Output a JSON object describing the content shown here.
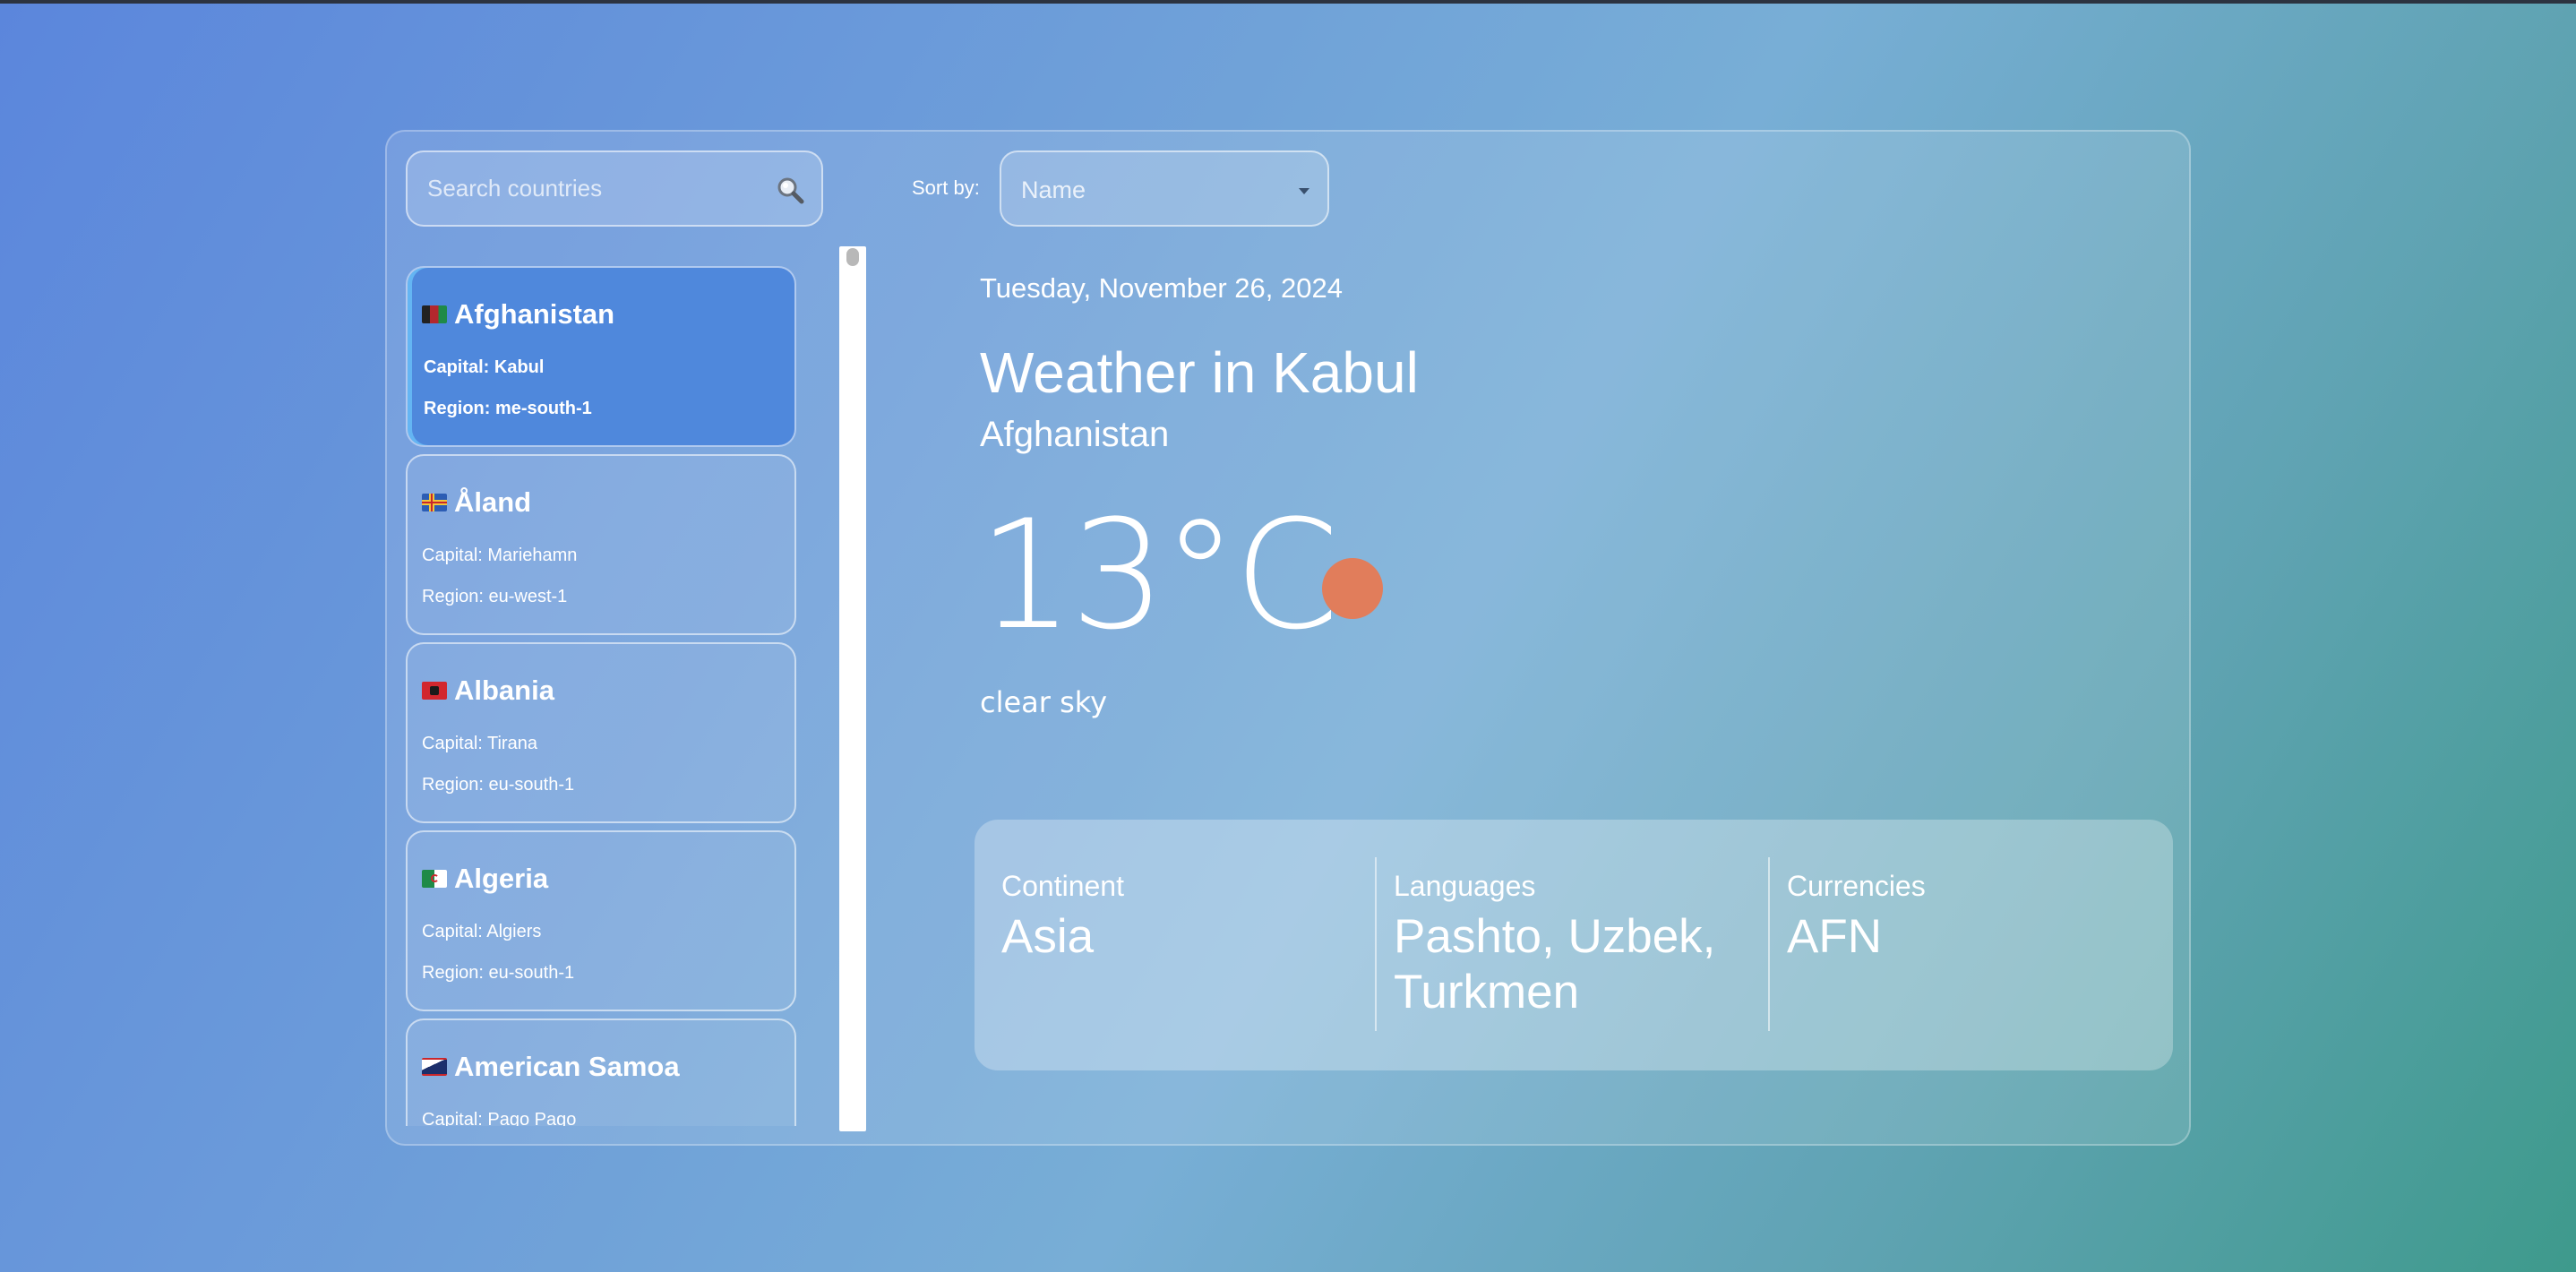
{
  "search": {
    "placeholder": "Search countries",
    "icon": "search-icon"
  },
  "sort": {
    "label": "Sort by:",
    "selected": "Name"
  },
  "countries": [
    {
      "name": "Afghanistan",
      "capital": "Capital: Kabul",
      "region": "Region: me-south-1",
      "selected": true
    },
    {
      "name": "Åland",
      "capital": "Capital: Mariehamn",
      "region": "Region: eu-west-1"
    },
    {
      "name": "Albania",
      "capital": "Capital: Tirana",
      "region": "Region: eu-south-1"
    },
    {
      "name": "Algeria",
      "capital": "Capital: Algiers",
      "region": "Region: eu-south-1"
    },
    {
      "name": "American Samoa",
      "capital": "Capital: Pago Pago",
      "region": ""
    }
  ],
  "weather": {
    "date": "Tuesday, November 26, 2024",
    "title": "Weather in Kabul",
    "country": "Afghanistan",
    "temperature": "13°C",
    "description": "clear sky",
    "icon": "sun-icon"
  },
  "info": {
    "continent_label": "Continent",
    "continent_value": "Asia",
    "languages_label": "Languages",
    "languages_value": "Pashto, Uzbek, Turkmen",
    "currencies_label": "Currencies",
    "currencies_value": "AFN"
  },
  "colors": {
    "selected_card": "#4f88dc",
    "sun": "#e17d5b"
  }
}
